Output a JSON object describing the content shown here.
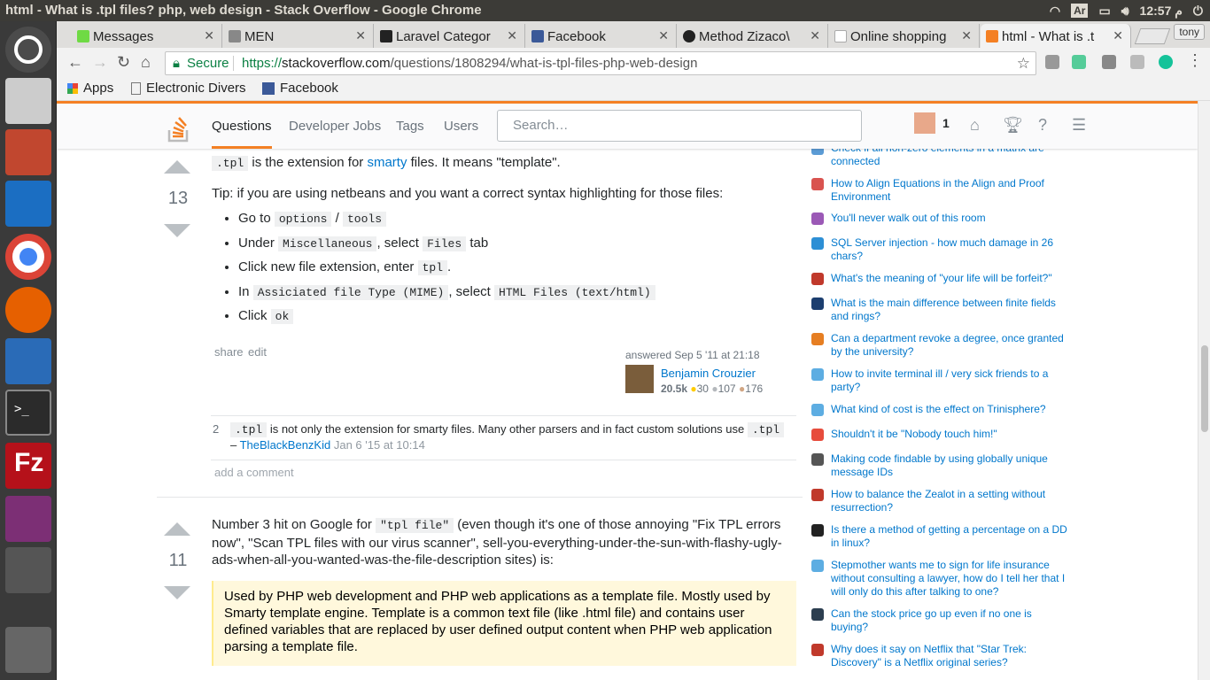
{
  "window": {
    "title": "html - What is .tpl files? php, web design - Stack Overflow - Google Chrome",
    "clock": "12:57 م",
    "user": "tony",
    "kbd": "Ar"
  },
  "tabs": [
    {
      "label": "Messages",
      "color": "#6fda44"
    },
    {
      "label": "MEN",
      "color": "#888"
    },
    {
      "label": "Laravel Categor",
      "color": "#222"
    },
    {
      "label": "Facebook",
      "color": "#3b5998"
    },
    {
      "label": "Method Zizaco\\",
      "color": "#222"
    },
    {
      "label": "Online shopping",
      "color": "#aaa"
    },
    {
      "label": "html - What is .t",
      "color": "#f48024"
    }
  ],
  "omnibox": {
    "secure": "Secure",
    "scheme": "https://",
    "host": "stackoverflow.com",
    "path": "/questions/1808294/what-is-tpl-files-php-web-design"
  },
  "bookmarks": [
    {
      "label": "Apps"
    },
    {
      "label": "Electronic Divers"
    },
    {
      "label": "Facebook"
    }
  ],
  "so": {
    "nav": [
      "Questions",
      "Developer Jobs",
      "Tags",
      "Users"
    ],
    "search_placeholder": "Search…",
    "rep_badge": "1"
  },
  "answer1": {
    "votes": "13",
    "p1a": ".tpl",
    "p1b": " is the extension for ",
    "p1link": "smarty",
    "p1c": " files. It means \"template\".",
    "tip": "Tip: if you are using netbeans and you want a correct syntax highlighting for those files:",
    "items": [
      {
        "pre": "Go to ",
        "c1": "options",
        "mid": " / ",
        "c2": "tools",
        "post": ""
      },
      {
        "pre": "Under ",
        "c1": "Miscellaneous",
        "mid": ", select ",
        "c2": "Files",
        "post": " tab"
      },
      {
        "pre": "Click new file extension, enter ",
        "c1": "tpl",
        "mid": ".",
        "c2": "",
        "post": ""
      },
      {
        "pre": "In ",
        "c1": "Assiciated file Type (MIME)",
        "mid": ", select ",
        "c2": "HTML Files (text/html)",
        "post": ""
      },
      {
        "pre": "Click ",
        "c1": "ok",
        "mid": "",
        "c2": "",
        "post": ""
      }
    ],
    "share": "share",
    "edit": "edit",
    "answered": "answered Sep 5 '11 at 21:18",
    "user": "Benjamin Crouzier",
    "rep": "20.5k",
    "gold": "30",
    "silver": "107",
    "bronze": "176"
  },
  "comment": {
    "score": "2",
    "code1": ".tpl",
    "text": " is not only the extension for smarty files. Many other parsers and in fact custom solutions use ",
    "code2": ".tpl",
    "dash": "– ",
    "author": "TheBlackBenzKid",
    "date": "Jan 6 '15 at 10:14",
    "add": "add a comment"
  },
  "answer2": {
    "votes": "11",
    "p1a": "Number 3 hit on Google for ",
    "code": "\"tpl file\"",
    "p1b": " (even though it's one of those annoying \"Fix TPL errors now\", \"Scan TPL files with our virus scanner\", sell-you-everything-under-the-sun-with-flashy-ugly-ads-when-all-you-wanted-was-the-file-description sites) is:",
    "quote": "Used by PHP web development and PHP web applications as a template file. Mostly used by Smarty template engine. Template is a common text file (like .html file) and contains user defined variables that are replaced by user defined output content when PHP web application parsing a template file."
  },
  "hot": [
    {
      "t": "Check if all non-zero elements in a matrix are connected",
      "c": "#5b9bd5"
    },
    {
      "t": "How to Align Equations in the Align and Proof Environment",
      "c": "#d9534f"
    },
    {
      "t": "You'll never walk out of this room",
      "c": "#9b59b6"
    },
    {
      "t": "SQL Server injection - how much damage in 26 chars?",
      "c": "#2d8fd5"
    },
    {
      "t": "What's the meaning of \"your life will be forfeit?\"",
      "c": "#c0392b"
    },
    {
      "t": "What is the main difference between finite fields and rings?",
      "c": "#1c3e6f"
    },
    {
      "t": "Can a department revoke a degree, once granted by the university?",
      "c": "#e67e22"
    },
    {
      "t": "How to invite terminal ill / very sick friends to a party?",
      "c": "#5dade2"
    },
    {
      "t": "What kind of cost is the effect on Trinisphere?",
      "c": "#5dade2"
    },
    {
      "t": "Shouldn't it be \"Nobody touch him!\"",
      "c": "#e74c3c"
    },
    {
      "t": "Making code findable by using globally unique message IDs",
      "c": "#555"
    },
    {
      "t": "How to balance the Zealot in a setting without resurrection?",
      "c": "#c0392b"
    },
    {
      "t": "Is there a method of getting a percentage on a DD in linux?",
      "c": "#222"
    },
    {
      "t": "Stepmother wants me to sign for life insurance without consulting a lawyer, how do I tell her that I will only do this after talking to one?",
      "c": "#5dade2"
    },
    {
      "t": "Can the stock price go up even if no one is buying?",
      "c": "#2c3e50"
    },
    {
      "t": "Why does it say on Netflix that \"Star Trek: Discovery\" is a Netflix original series?",
      "c": "#c0392b"
    }
  ]
}
